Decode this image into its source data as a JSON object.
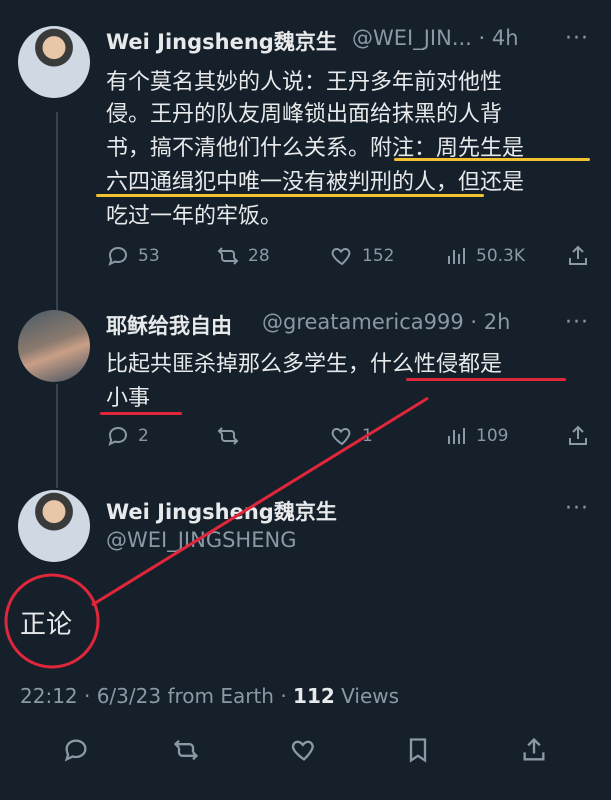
{
  "tweet1": {
    "display_name": "Wei Jingsheng魏京生",
    "handle_time": "@WEI_JIN... · 4h",
    "lines": [
      "有个莫名其妙的人说：王丹多年前对他性",
      "侵。王丹的队友周峰锁出面给抹黑的人背",
      "书，搞不清他们什么关系。附注：周先生是",
      "六四通缉犯中唯一没有被判刑的人，但还是",
      "吃过一年的牢饭。"
    ],
    "reply_count": "53",
    "retweet_count": "28",
    "like_count": "152",
    "view_count": "50.3K"
  },
  "tweet2": {
    "display_name": "耶稣给我自由",
    "handle_time": "@greatamerica999 · 2h",
    "lines": [
      "比起共匪杀掉那么多学生，什么性侵都是",
      "小事"
    ],
    "reply_count": "2",
    "retweet_count": "",
    "like_count": "1",
    "view_count": "109"
  },
  "main": {
    "display_name": "Wei Jingsheng魏京生",
    "handle": "@WEI_JINGSHENG",
    "text": "正论",
    "timestamp": "22:12 · 6/3/23 from Earth · ",
    "views_count": "112",
    "views_label": " Views"
  },
  "more_glyph": "···",
  "colors": {
    "background": "#15202b",
    "text": "#e7e9ea",
    "muted": "#8b98a5",
    "annotation_yellow": "#f2c230",
    "annotation_red": "#e0263a"
  },
  "icons": {
    "reply": "reply-icon",
    "retweet": "retweet-icon",
    "like": "like-icon",
    "views": "views-icon",
    "share": "share-icon",
    "bookmark": "bookmark-icon"
  }
}
